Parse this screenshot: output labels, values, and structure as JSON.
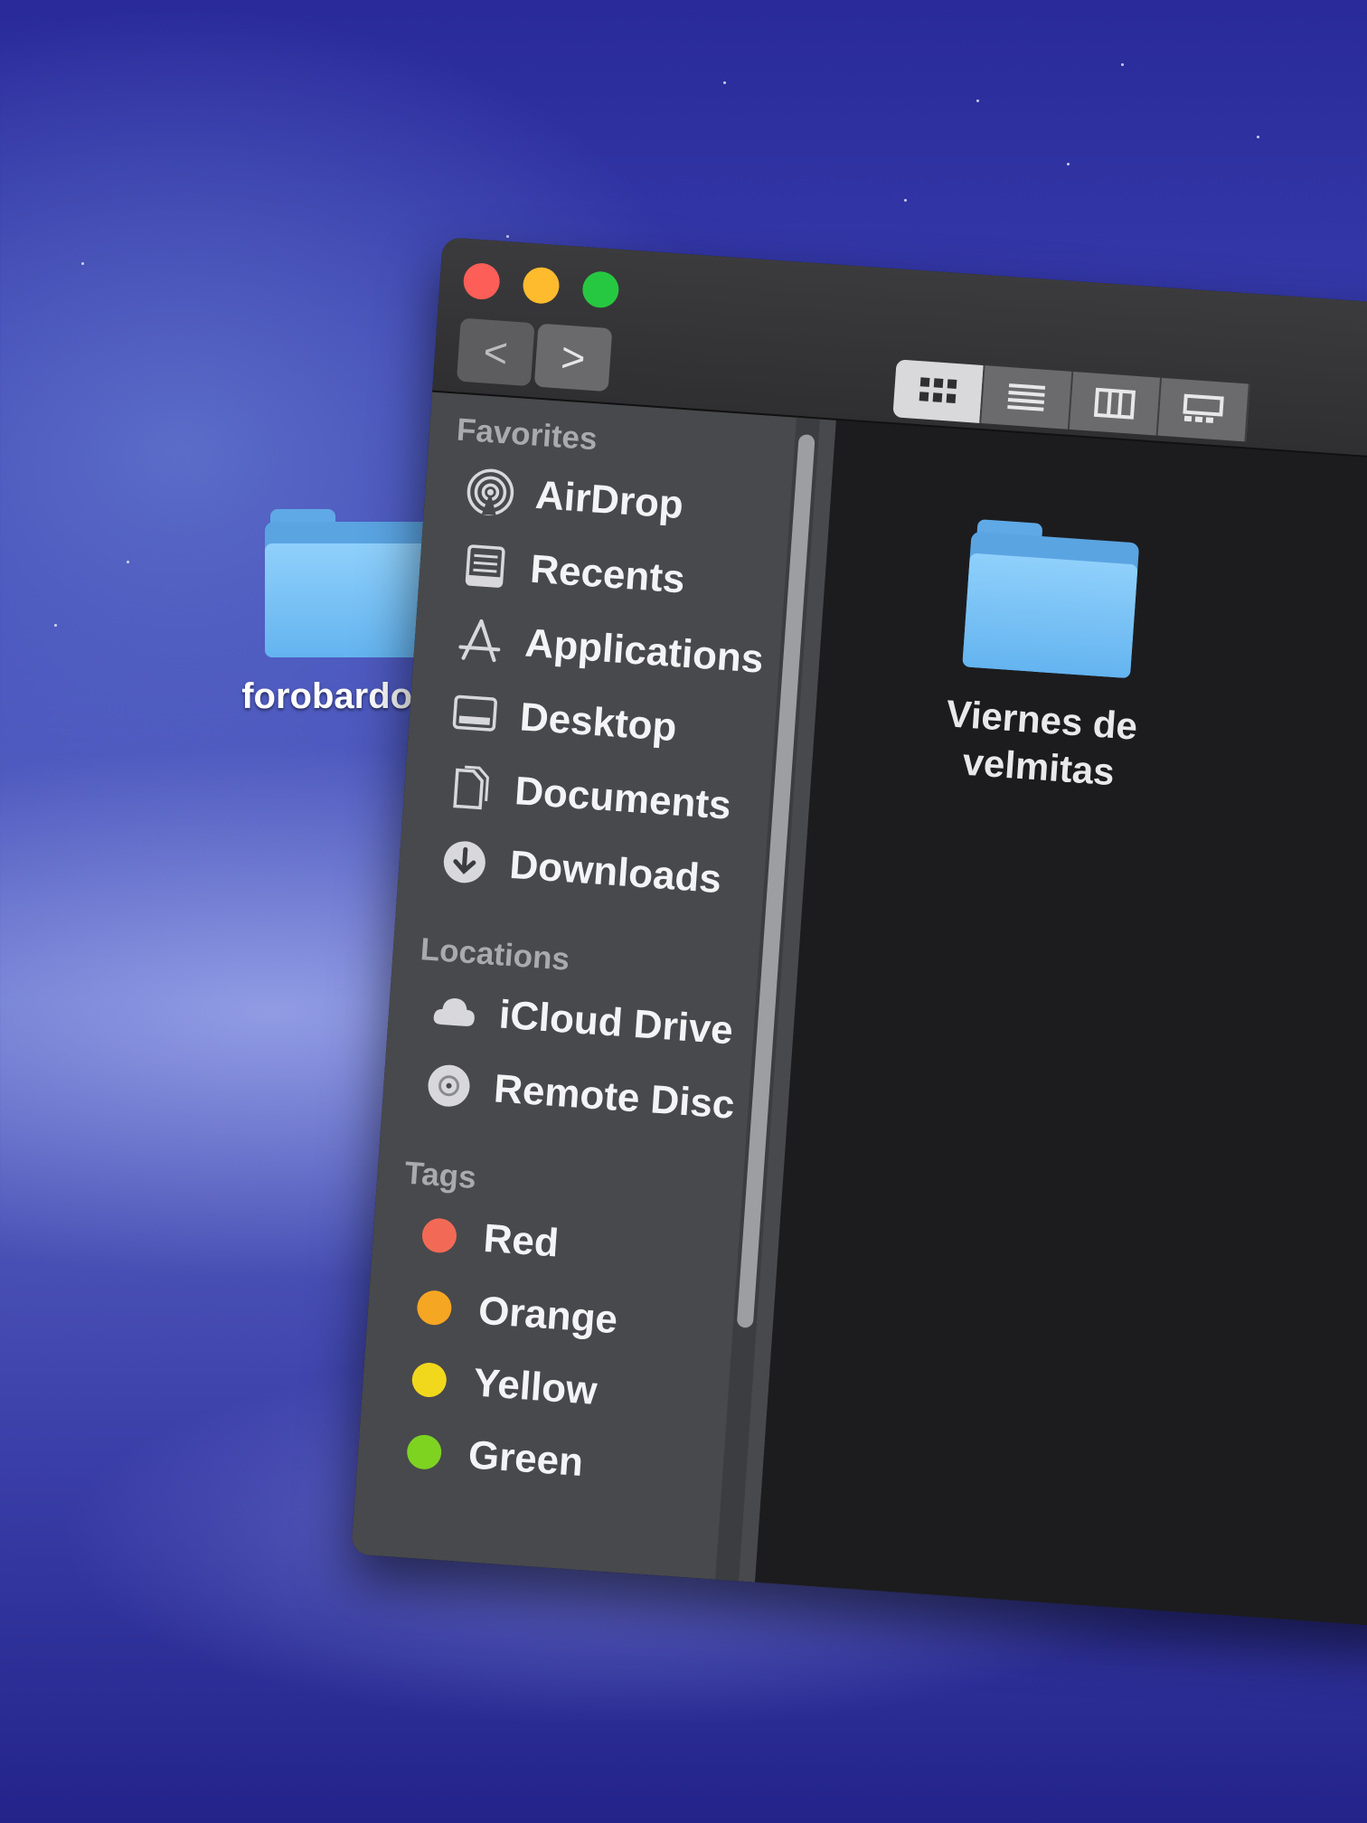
{
  "desktop": {
    "folder_name": "forobardo.tk"
  },
  "window": {
    "toolbar": {
      "back_glyph": "<",
      "forward_glyph": ">",
      "view_modes": [
        "icon-view",
        "list-view",
        "column-view",
        "gallery-view"
      ],
      "active_view": "icon-view"
    },
    "sidebar": {
      "favorites_header": "Favorites",
      "favorites": [
        {
          "label": "AirDrop",
          "icon": "airdrop-icon"
        },
        {
          "label": "Recents",
          "icon": "recents-icon"
        },
        {
          "label": "Applications",
          "icon": "applications-icon"
        },
        {
          "label": "Desktop",
          "icon": "desktop-icon"
        },
        {
          "label": "Documents",
          "icon": "documents-icon"
        },
        {
          "label": "Downloads",
          "icon": "downloads-icon"
        }
      ],
      "locations_header": "Locations",
      "locations": [
        {
          "label": "iCloud Drive",
          "icon": "icloud-icon"
        },
        {
          "label": "Remote Disc",
          "icon": "disc-icon"
        }
      ],
      "tags_header": "Tags",
      "tags": [
        {
          "label": "Red",
          "color": "#f26a55"
        },
        {
          "label": "Orange",
          "color": "#f5a623"
        },
        {
          "label": "Yellow",
          "color": "#f2d81c"
        },
        {
          "label": "Green",
          "color": "#7ed321"
        }
      ]
    },
    "content": {
      "items": [
        {
          "name": "Viernes de velmitas",
          "kind": "folder"
        }
      ]
    }
  }
}
